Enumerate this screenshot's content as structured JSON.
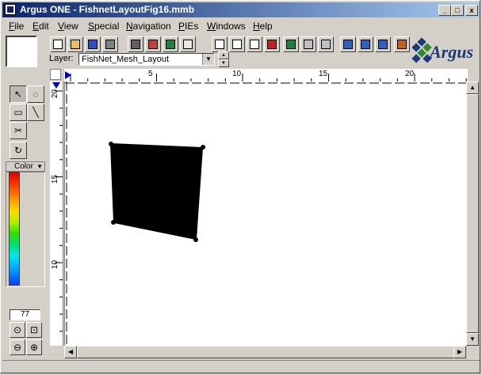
{
  "window": {
    "title": "Argus ONE - FishnetLayoutFig16.mmb",
    "controls": {
      "minimize": "_",
      "maximize": "□",
      "close": "x"
    }
  },
  "menu": [
    {
      "label": "File",
      "u": "F",
      "rest": "ile"
    },
    {
      "label": "Edit",
      "u": "E",
      "rest": "dit"
    },
    {
      "label": "View",
      "u": "V",
      "rest": "iew"
    },
    {
      "label": "Special",
      "u": "S",
      "rest": "pecial"
    },
    {
      "label": "Navigation",
      "u": "N",
      "rest": "avigation"
    },
    {
      "label": "PIEs",
      "u": "P",
      "rest": "IEs"
    },
    {
      "label": "Windows",
      "u": "W",
      "rest": "indows"
    },
    {
      "label": "Help",
      "u": "H",
      "rest": "elp"
    }
  ],
  "toolbar": {
    "layer_label": "Layer:",
    "layer_value": "FishNet_Mesh_Layout",
    "icons": [
      "new-icon",
      "open-icon",
      "save-icon",
      "print-icon",
      "find-icon",
      "pie-icon",
      "layers-icon",
      "grid-icon",
      "split-icon",
      "table-icon",
      "chart-icon",
      "delete-icon",
      "book-icon",
      "mesh-edit-icon",
      "mesh-add-icon",
      "eye-icon",
      "edit-eye-icon",
      "calc-icon",
      "network-icon"
    ]
  },
  "logo": {
    "text": "Argus"
  },
  "ruler": {
    "top_labels": [
      "5",
      "10",
      "15",
      "20"
    ],
    "left_labels": [
      "20",
      "15",
      "10"
    ]
  },
  "palette": {
    "color_label": "Color",
    "zoom_value": "77",
    "tools": [
      "select-arrow-icon",
      "lasso-icon",
      "rectangle-select-icon",
      "line-tool-icon",
      "scissors-icon",
      "rotate-tool-icon"
    ]
  },
  "colors": {
    "title_start": "#0a246a",
    "title_end": "#a6caf0",
    "shape_fill": "#000000"
  }
}
